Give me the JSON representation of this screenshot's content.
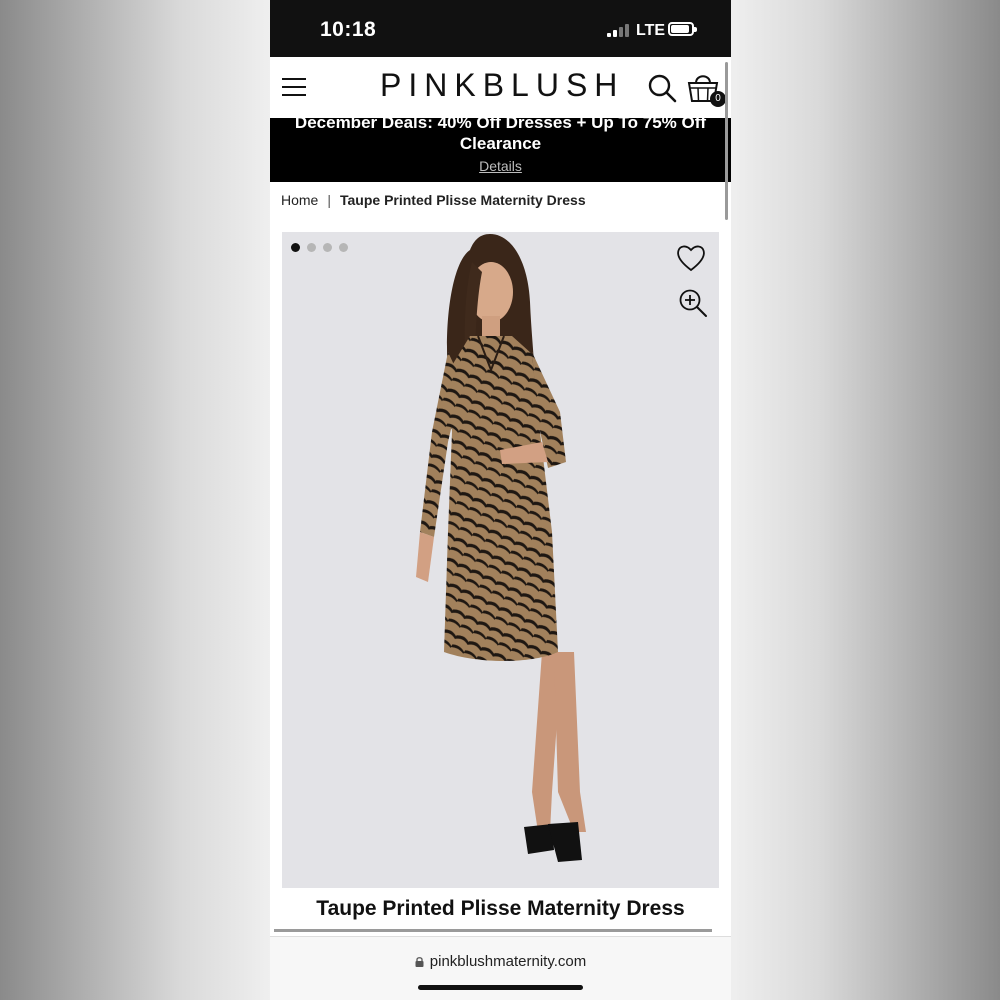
{
  "status_bar": {
    "time": "10:18",
    "carrier": "LTE"
  },
  "header": {
    "brand": "PINKBLUSH",
    "cart_count": "0"
  },
  "promo": {
    "title": "December Deals: 40% Off Dresses + Up To 75% Off Clearance",
    "link": "Details"
  },
  "breadcrumb": {
    "home": "Home",
    "separator": "|",
    "current": "Taupe Printed Plisse Maternity Dress"
  },
  "gallery": {
    "total_images": 4,
    "active_index": 0
  },
  "product": {
    "title": "Taupe Printed Plisse Maternity Dress"
  },
  "browser": {
    "url": "pinkblushmaternity.com"
  },
  "colors": {
    "brand_dark": "#111111",
    "promo_bg": "#000000",
    "gallery_bg": "#e3e3e7",
    "dress": "#9a7a57"
  },
  "icons": [
    "hamburger-menu-icon",
    "search-icon",
    "shopping-bag-icon",
    "heart-icon",
    "zoom-in-icon",
    "lock-icon"
  ]
}
